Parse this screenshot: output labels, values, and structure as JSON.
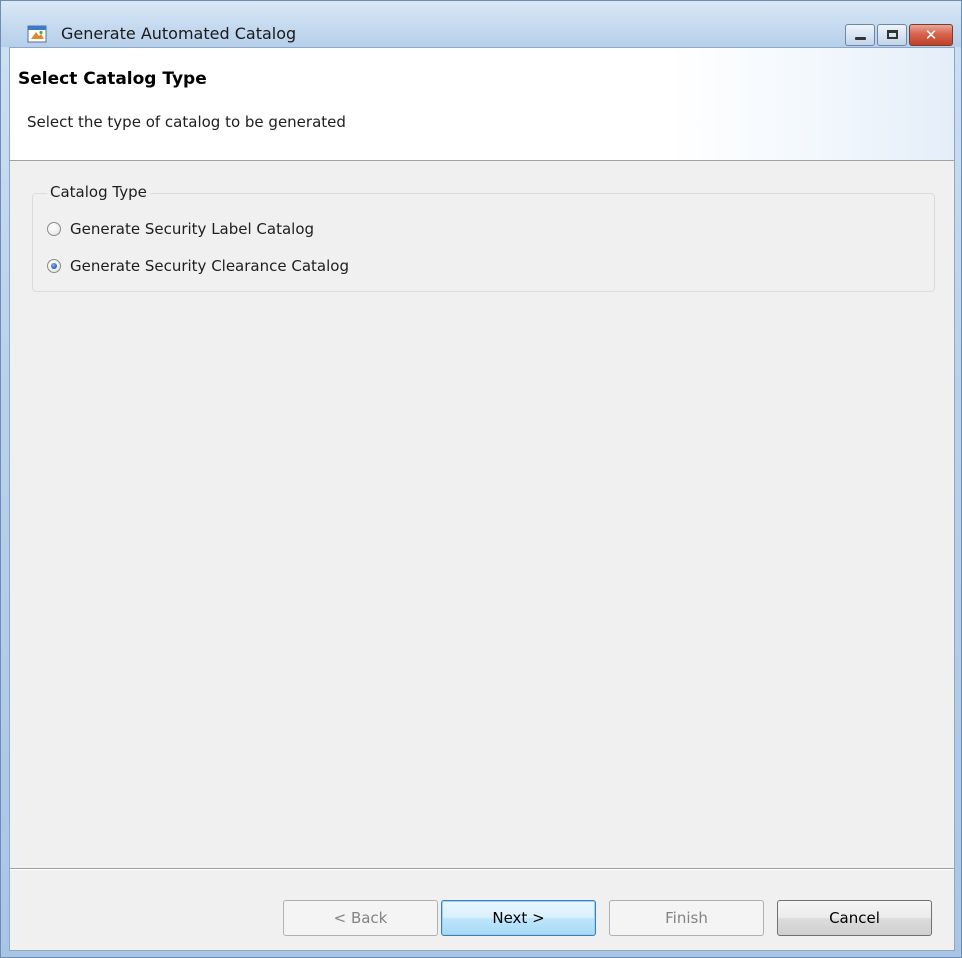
{
  "window": {
    "title": "Generate Automated Catalog",
    "icon": "catalog-app-icon"
  },
  "header": {
    "title": "Select Catalog Type",
    "description": "Select the type of catalog to be generated"
  },
  "catalog_type": {
    "legend": "Catalog Type",
    "options": [
      {
        "label": "Generate Security Label Catalog",
        "checked": false
      },
      {
        "label": "Generate Security Clearance Catalog",
        "checked": true
      }
    ]
  },
  "buttons": {
    "back": "< Back",
    "next": "Next >",
    "finish": "Finish",
    "cancel": "Cancel"
  },
  "colors": {
    "titlebar": "#c7dbf0",
    "close_button": "#c0412a",
    "default_button_border": "#3c7fb1",
    "radio_selected": "#2b6fb6"
  }
}
